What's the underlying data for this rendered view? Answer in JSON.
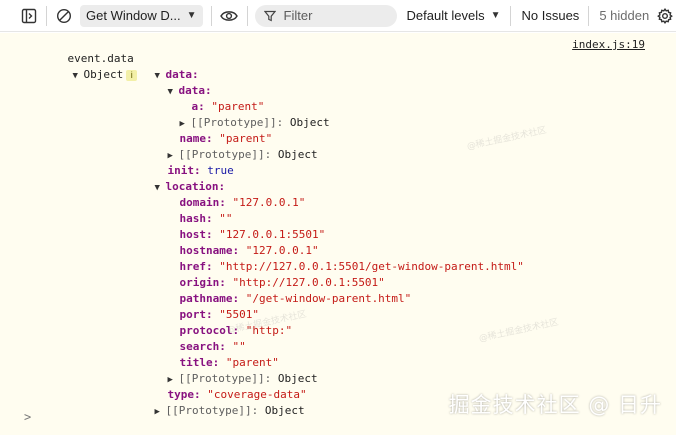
{
  "toolbar": {
    "context_label": "Get Window D...",
    "filter_placeholder": "Filter",
    "levels_label": "Default levels",
    "issues_label": "No Issues",
    "hidden_label": "5 hidden"
  },
  "console": {
    "log_label": "event.data",
    "source_link": "index.js:19",
    "info_badge": "i",
    "lines": {
      "root_type": "Object",
      "data_key": "data:",
      "data2_key": "data:",
      "a_key": "a:",
      "a_val": "\"parent\"",
      "proto1_key": "[[Prototype]]:",
      "proto1_val": "Object",
      "name_key": "name:",
      "name_val": "\"parent\"",
      "proto2_key": "[[Prototype]]:",
      "proto2_val": "Object",
      "init_key": "init:",
      "init_val": "true",
      "location_key": "location:",
      "domain_key": "domain:",
      "domain_val": "\"127.0.0.1\"",
      "hash_key": "hash:",
      "hash_val": "\"\"",
      "host_key": "host:",
      "host_val": "\"127.0.0.1:5501\"",
      "hostname_key": "hostname:",
      "hostname_val": "\"127.0.0.1\"",
      "href_key": "href:",
      "href_val": "\"http://127.0.0.1:5501/get-window-parent.html\"",
      "origin_key": "origin:",
      "origin_val": "\"http://127.0.0.1:5501\"",
      "pathname_key": "pathname:",
      "pathname_val": "\"/get-window-parent.html\"",
      "port_key": "port:",
      "port_val": "\"5501\"",
      "protocol_key": "protocol:",
      "protocol_val": "\"http:\"",
      "search_key": "search:",
      "search_val": "\"\"",
      "title_key": "title:",
      "title_val": "\"parent\"",
      "proto3_key": "[[Prototype]]:",
      "proto3_val": "Object",
      "type_key": "type:",
      "type_val": "\"coverage-data\"",
      "proto4_key": "[[Prototype]]:",
      "proto4_val": "Object"
    },
    "prompt": ">"
  },
  "watermarks": {
    "overlay_1": "@稀土掘金技术社区",
    "overlay_2": "@稀土掘金技术社区",
    "overlay_3": "@稀土掘金技术社区",
    "corner": "掘金技术社区 @ 日升"
  },
  "icons": [
    "dock-side-icon",
    "clear-console-icon",
    "eye-icon",
    "filter-icon",
    "settings-gear-icon"
  ]
}
